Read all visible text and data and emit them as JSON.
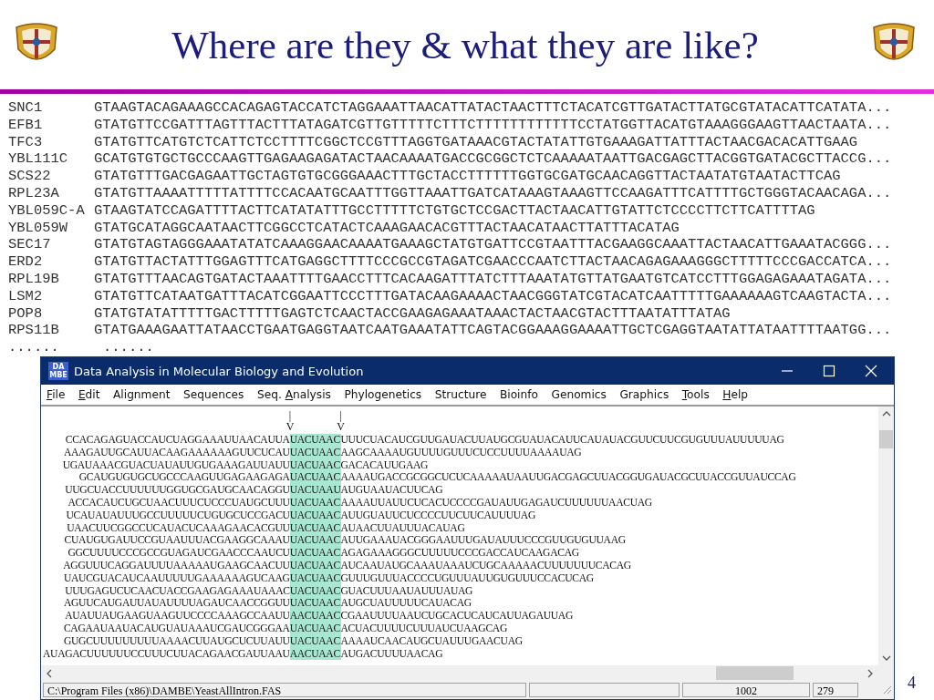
{
  "slide": {
    "title": "Where are they & what they are like?",
    "page_number": "4"
  },
  "sequence_list": {
    "rows": [
      {
        "name": "SNC1",
        "sequence": "GTAAGTACAGAAAGCCACAGAGTACCATCTAGGAAATTAACATTATACTAACTTTCTACATCGTTGATACTTATGCGTATACATTCATATA..."
      },
      {
        "name": "EFB1",
        "sequence": "GTATGTTCCGATTTAGTTTACTTTATAGATCGTTGTTTTTCTTTCTTTTTTTTTTTTCCTATGGTTACATGTAAAGGGAAGTTAACTAATA..."
      },
      {
        "name": "TFC3",
        "sequence": "GTATGTTCATGTCTCATTCTCCTTTTCGGCTCCGTTTAGGTGATAAACGTACTATATTGTGAAAGATTATTTACTAACGACACATTGAAG"
      },
      {
        "name": "YBL111C",
        "sequence": "GCATGTGTGCTGCCCAAGTTGAGAAGAGATACTAACAAAATGACCGCGGCTCTCAAAAATAATTGACGAGCTTACGGTGATACGCTTACCG..."
      },
      {
        "name": "SCS22",
        "sequence": "GTATGTTTGACGAGAATTGCTAGTGTGCGGGAAACTTTGCTACCTTTTTTGGTGCGATGCAACAGGTTACTAATATGTAATACTTCAG"
      },
      {
        "name": "RPL23A",
        "sequence": "GTATGTTAAAATTTTTATTTTCCACAATGCAATTTGGTTAAATTGATCATAAAGTAAAGTTCCAAGATTTCATTTTGCTGGGTACAACAGA..."
      },
      {
        "name": "YBL059C-A",
        "sequence": "GTAAGTATCCAGATTTTACTTCATATATTTGCCTTTTTCTGTGCTCCGACTTACTAACATTGTATTCTCCCCTTCTTCATTTTAG"
      },
      {
        "name": "YBL059W",
        "sequence": "GTATGCATAGGCAATAACTTCGGCCTCATACTCAAAGAACACGTTTACTAACATAACTTATTTACATAG"
      },
      {
        "name": "SEC17",
        "sequence": "GTATGTAGTAGGGAAATATATCAAAGGAACAAAATGAAAGCTATGTGATTCCGTAATTTACGAAGGCAAATTACTAACATTGAAATACGGG..."
      },
      {
        "name": "ERD2",
        "sequence": "GTATGTTACTATTTGGAGTTTCATGAGGCTTTTCCCGCCGTAGATCGAACCCAATCTTACTAACAGAGAAAGGGCTTTTTCCCGACCATCA..."
      },
      {
        "name": "RPL19B",
        "sequence": "GTATGTTTAACAGTGATACTAAATTTTGAACCTTTCACAAGATTTATCTTTAAATATGTTATGAATGTCATCCTTTGGAGAGAAATAGATA..."
      },
      {
        "name": "LSM2",
        "sequence": "GTATGTTCATAATGATTTACATCGGAATTCCCTTTGATACAAGAAAACTAACGGGTATCGTACATCAATTTTTGAAAAAAGTCAAGTACTA..."
      },
      {
        "name": "POP8",
        "sequence": "GTATGTATATTTTTGACTTTTTGAGTCTCAACTACCGAAGAGAAATAAACTACTAACGTACTTTAATATTTATAG"
      },
      {
        "name": "RPS11B",
        "sequence": "GTATGAAAGAATTATAACCTGAATGAGGTAATCAATGAAATATTCAGTACGGAAAGGAAAATTGCTCGAGGTAATATTATAATTTTAATGG..."
      }
    ],
    "more": [
      "......",
      "......"
    ]
  },
  "window": {
    "title": "Data Analysis in Molecular Biology and Evolution",
    "app_icon": [
      "DA",
      "MBE"
    ],
    "menu": [
      {
        "key": "F",
        "post": "ile"
      },
      {
        "key": "E",
        "post": "dit"
      },
      {
        "label": "Alignment"
      },
      {
        "label": "Sequences"
      },
      {
        "pre": "Seq. ",
        "key": "A",
        "post": "nalysis"
      },
      {
        "label": "Phylogenetics"
      },
      {
        "label": "Structure"
      },
      {
        "label": "Bioinfo"
      },
      {
        "label": "Genomics"
      },
      {
        "label": "Graphics"
      },
      {
        "key": "T",
        "post": "ools"
      },
      {
        "key": "H",
        "post": "elp"
      }
    ],
    "markers": [
      {
        "stem": "|",
        "head": "V"
      },
      {
        "stem": "|",
        "head": "V"
      }
    ],
    "lines": [
      {
        "before": "CCACAGAGUACCAUCUAGGAAAUUAACAUUA",
        "motif": "UACUAAC",
        "after": "UUUCUACAUCGUUGAUACUUAUGCGUAUACAUUCAUAUACGUUCUUCGUGUUUAUUUUUAG"
      },
      {
        "before": "AAAGAUUGCAUUACAAGAAAAAAGUUCUCAU",
        "motif": "UACUAAC",
        "after": "AAGCAAAAUGUUUUGUUUCUCCUUUUAAAAUAG"
      },
      {
        "before": "UGAUAAACGUACUAUAUUGUGAAAGAUUAUU",
        "motif": "UACUAAC",
        "after": "GACACAUUGAAG"
      },
      {
        "before": "GCAUGUGUGCUGCCCAAGUUGAGAAGAGA",
        "motif": "UACUAAC",
        "after": "AAAAUGACCGCGGCUCUCAAAAAUAAUUGACGAGCUUACGGUGAUACGCUUACCGUUAUCCAG"
      },
      {
        "before": "UUGCUACCUUUUUUGGUGCGAUGCAACAGGU",
        "motif": "UACUAAU",
        "after": "AUGUAAUACUUCAG"
      },
      {
        "before": "ACCACAUCUGCUAACUUUCUCCCUAUGCUUU",
        "motif": "UACUAAC",
        "after": "AAAAUUAUUCUCACUCCCCGAUAUUGAGAUCUUUUUUAACUAG"
      },
      {
        "before": "UCAUAUAUUUGCCUUUUUCUGUGCUCCGACU",
        "motif": "UACUAAC",
        "after": "AUUGUAUUCUCCCCUUCUUCAUUUUAG"
      },
      {
        "before": "UAACUUCGGCCUCAUACUCAAAGAACACGUU",
        "motif": "UACUAAC",
        "after": "AUAACUUAUUUACAUAG"
      },
      {
        "before": "CUAUGUGAUUCCGUAAUUUACGAAGGCAAAU",
        "motif": "UACUAAC",
        "after": "AUUGAAAUACGGGAAUUUGAUAUUUCCCGUUGUGUUAAG"
      },
      {
        "before": "GGCUUUUCCCGCCGUAGAUCGAACCCAAUCU",
        "motif": "UACUAAC",
        "after": "AGAGAAAGGGCUUUUUCCCGACCAUCAAGACAG"
      },
      {
        "before": "AGGUUUCAGGAUUUUAAAAAUGAAGCAACUU",
        "motif": "UACUAAC",
        "after": "AUCAAUAUGCAAAUAAAUCUGCAAAAACUUUUUUUCACAG"
      },
      {
        "before": "UAUCGUACAUCAAUUUUUGAAAAAAGUCAAG",
        "motif": "UACUAAC",
        "after": "GUUUGUUUACCCCUGUUUAUUGUGUUUCCACUCAG"
      },
      {
        "before": "UUUGAGUCUCAACUACCGAAGAGAAAUAAAC",
        "motif": "UACUAAC",
        "after": "GUACUUUAAUAUUUAUAG"
      },
      {
        "before": "AGUUCAUGAUUAUAUUUUAGAUCAACCGGUU",
        "motif": "UACUAAC",
        "after": "AUGCUAUUUUUCAUACAG"
      },
      {
        "before": "AUAUUAUGAAGUAAGUUCCCCAAAGCCAAUU",
        "motif": "AACUAAC",
        "after": "CGAAUUUUAAUCUGCACUCAUCAUUAGAUUAG"
      },
      {
        "before": "CAGAAUAAUACAUGUAUAAAUCGAUCGGGAA",
        "motif": "UACUAAC",
        "after": "ACUACUUUUCUUUAUCUAAGCAG"
      },
      {
        "before": "GUGCUUUUUUUUUAAAACUUAUGCUCUUAUU",
        "motif": "UACUAAC",
        "after": "AAAAUCAACAUGCUAUUUGAACUAG"
      },
      {
        "before": "AUAGACUUUUUUCCUUUCUUACAGAACGAUUAAU",
        "motif": "AACUAAC",
        "after": "AUGACUUUUAACAG"
      }
    ],
    "status_bar": {
      "path": "C:\\Program Files (x86)\\DAMBE\\YeastAllIntron.FAS",
      "field_3": "1002",
      "field_4": "279"
    }
  }
}
